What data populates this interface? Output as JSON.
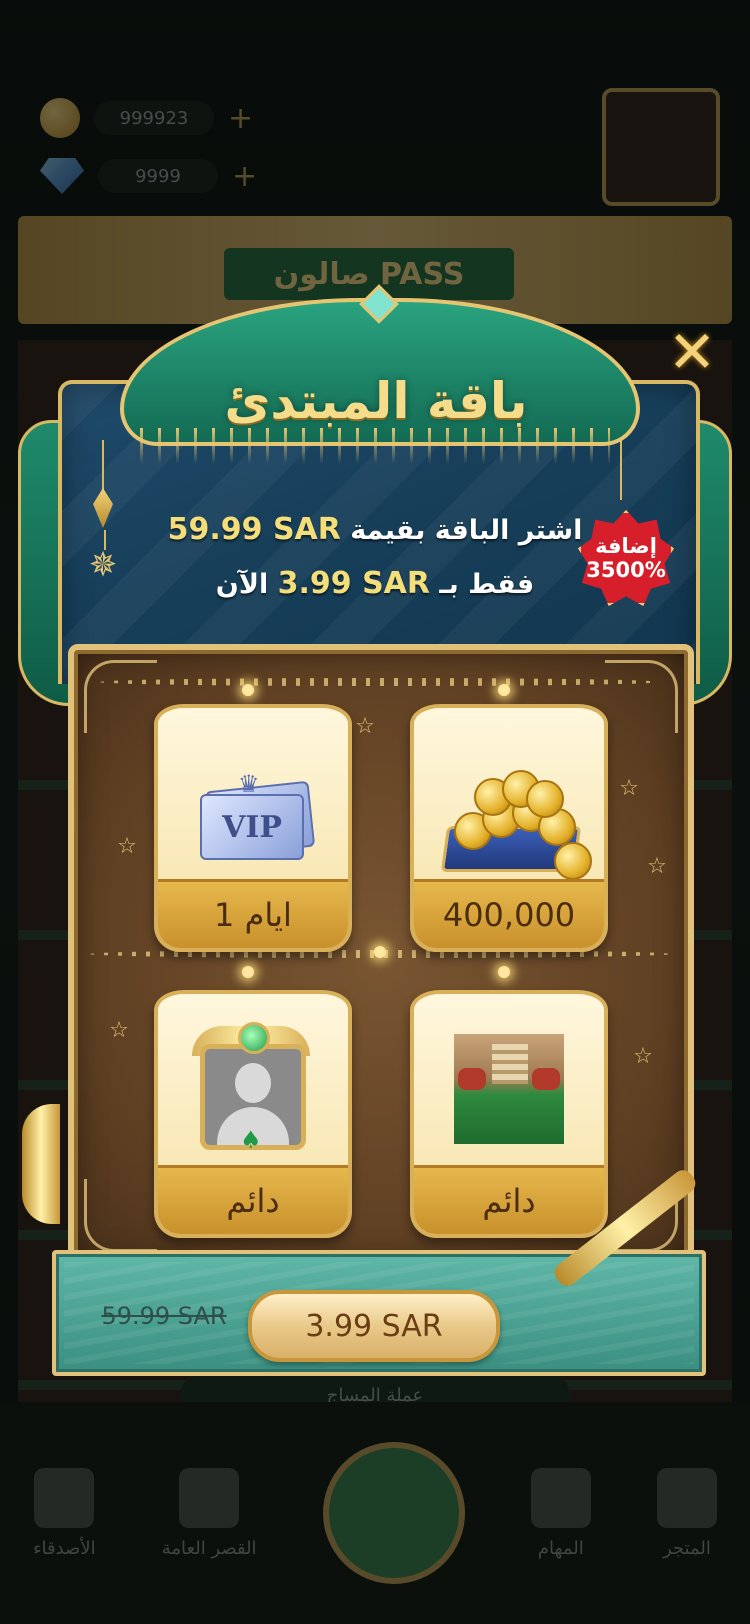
{
  "background": {
    "coins": "999923",
    "gems": "9999",
    "banner": "صالون PASS",
    "strip": "عملة المساج",
    "nav": [
      {
        "label": "الأصدقاء",
        "icon": "friends-icon"
      },
      {
        "label": "القصر العامة",
        "icon": "palace-icon"
      },
      {
        "label": "",
        "icon": "play-table-icon"
      },
      {
        "label": "المهام",
        "icon": "tasks-icon"
      },
      {
        "label": "المتجر",
        "icon": "cart-icon"
      }
    ]
  },
  "popup": {
    "title": "باقة المبتدئ",
    "offer_prefix": "اشتر الباقة بقيمة",
    "offer_value_price": "59.99 SAR",
    "offer_only": "فقط بـ",
    "offer_price": "3.99 SAR",
    "offer_now": "الآن",
    "bonus_label": "إضافة",
    "bonus_value": "3500%",
    "items": [
      {
        "label": "400,000",
        "icon": "gold-coins-icon"
      },
      {
        "label": "1 ايام",
        "icon": "vip-card-icon"
      },
      {
        "label": "دائم",
        "icon": "game-table-icon"
      },
      {
        "label": "دائم",
        "icon": "avatar-frame-icon"
      }
    ],
    "old_price": "59.99 SAR",
    "buy_label": "3.99 SAR",
    "close_icon": "close-x-icon",
    "colors": {
      "header_green": "#1f8a6b",
      "gold": "#e1c27a",
      "board_brown": "#5e3f22",
      "buybar_teal": "#4fa595",
      "bonus_red": "#d61f2a"
    }
  }
}
